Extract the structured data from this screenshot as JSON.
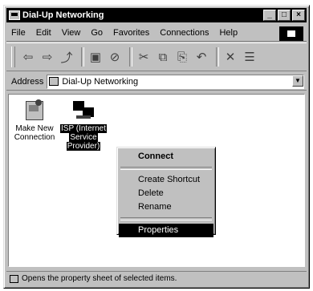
{
  "window": {
    "title": "Dial-Up Networking",
    "controls": [
      "_",
      "□",
      "×"
    ]
  },
  "menu": [
    {
      "label": "File"
    },
    {
      "label": "Edit"
    },
    {
      "label": "View"
    },
    {
      "label": "Go"
    },
    {
      "label": "Favorites"
    },
    {
      "label": "Connections"
    },
    {
      "label": "Help"
    }
  ],
  "toolbar": {
    "back": "⇦",
    "forward": "⇨",
    "up": "⤴",
    "map_drive": "▣",
    "disconnect": "⊘",
    "cut": "✂",
    "copy": "⧉",
    "paste": "⎘",
    "undo": "↶",
    "delete": "✕",
    "properties": "☰"
  },
  "address": {
    "label": "Address",
    "value": "Dial-Up Networking"
  },
  "icons": [
    {
      "label_line1": "Make New",
      "label_line2": "Connection"
    },
    {
      "label_line1": "ISP (Internet",
      "label_line2": "Service",
      "label_line3": "Provider)"
    }
  ],
  "context_menu": {
    "connect": "Connect",
    "create_shortcut": "Create Shortcut",
    "delete": "Delete",
    "rename": "Rename",
    "properties": "Properties"
  },
  "status": {
    "text": "Opens the property sheet of selected items."
  }
}
